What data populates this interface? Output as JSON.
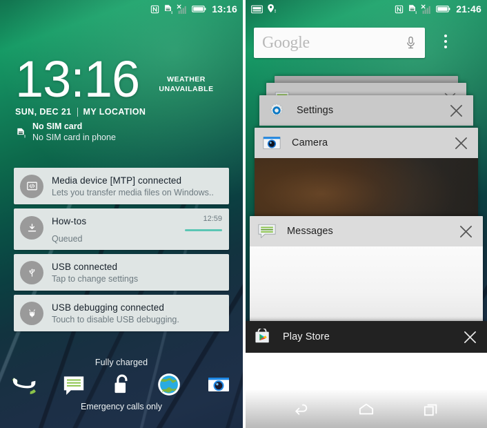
{
  "left_phone": {
    "status_bar": {
      "icons_right": [
        "nfc-icon",
        "sim-alert-icon",
        "signal-no-service-icon",
        "battery-full-icon"
      ],
      "time": "13:16"
    },
    "lockscreen": {
      "clock": "13:16",
      "weather_line1": "WEATHER",
      "weather_line2": "UNAVAILABLE",
      "date_day": "SUN, DEC",
      "date_num": "21",
      "location": "MY LOCATION",
      "sim_title": "No SIM card",
      "sim_sub": "No SIM card in phone"
    },
    "notifications": [
      {
        "icon": "media-device-icon",
        "title": "Media device [MTP] connected",
        "subtitle": "Lets you transfer media files on Windows..",
        "time": "",
        "has_progress": false
      },
      {
        "icon": "download-icon",
        "title": "How-tos",
        "subtitle": "Queued",
        "time": "12:59",
        "has_progress": true
      },
      {
        "icon": "usb-icon",
        "title": "USB connected",
        "subtitle": "Tap to change settings",
        "time": "",
        "has_progress": false
      },
      {
        "icon": "android-debug-icon",
        "title": "USB debugging connected",
        "subtitle": "Touch to disable USB debugging.",
        "time": "",
        "has_progress": false
      }
    ],
    "battery_status": "Fully charged",
    "emergency_text": "Emergency calls only",
    "shortcuts": [
      {
        "name": "phone-shortcut",
        "icon": "phone-icon"
      },
      {
        "name": "messages-shortcut",
        "icon": "messages-icon"
      },
      {
        "name": "unlock-shortcut",
        "icon": "lock-icon"
      },
      {
        "name": "browser-shortcut",
        "icon": "globe-icon"
      },
      {
        "name": "camera-shortcut",
        "icon": "camera-icon"
      }
    ]
  },
  "right_phone": {
    "status_bar": {
      "icons_left": [
        "keyboard-icon",
        "location-alert-icon"
      ],
      "icons_right": [
        "nfc-icon",
        "sim-alert-icon",
        "signal-no-service-icon",
        "battery-full-icon"
      ],
      "time": "21:46"
    },
    "search": {
      "logo_text": "Google",
      "placeholder": "Google",
      "mic_icon": "microphone-icon",
      "overflow_icon": "overflow-menu-icon"
    },
    "recents_cards": [
      {
        "title": "Settings",
        "icon": "settings-gear-icon",
        "close_label": "×",
        "theme": "light"
      },
      {
        "title": "Camera",
        "icon": "camera-app-icon",
        "close_label": "×",
        "theme": "light"
      },
      {
        "title": "Messages",
        "icon": "messages-app-icon",
        "close_label": "×",
        "theme": "light"
      },
      {
        "title": "Play Store",
        "icon": "play-store-icon",
        "close_label": "×",
        "theme": "dark"
      }
    ],
    "nav_bar": [
      {
        "name": "back-button",
        "icon": "back-arrow-icon"
      },
      {
        "name": "home-button",
        "icon": "home-icon"
      },
      {
        "name": "recents-button",
        "icon": "recents-icon"
      }
    ]
  },
  "colors": {
    "wallpaper_green": "#15915f",
    "wallpaper_navy": "#1c2c45",
    "notification_card": "#dfe5e4",
    "progress_teal": "#5bc6b4",
    "recents_header": "#d0d0d0",
    "playstore_header": "#222222",
    "accent_green": "#8bc34a"
  }
}
